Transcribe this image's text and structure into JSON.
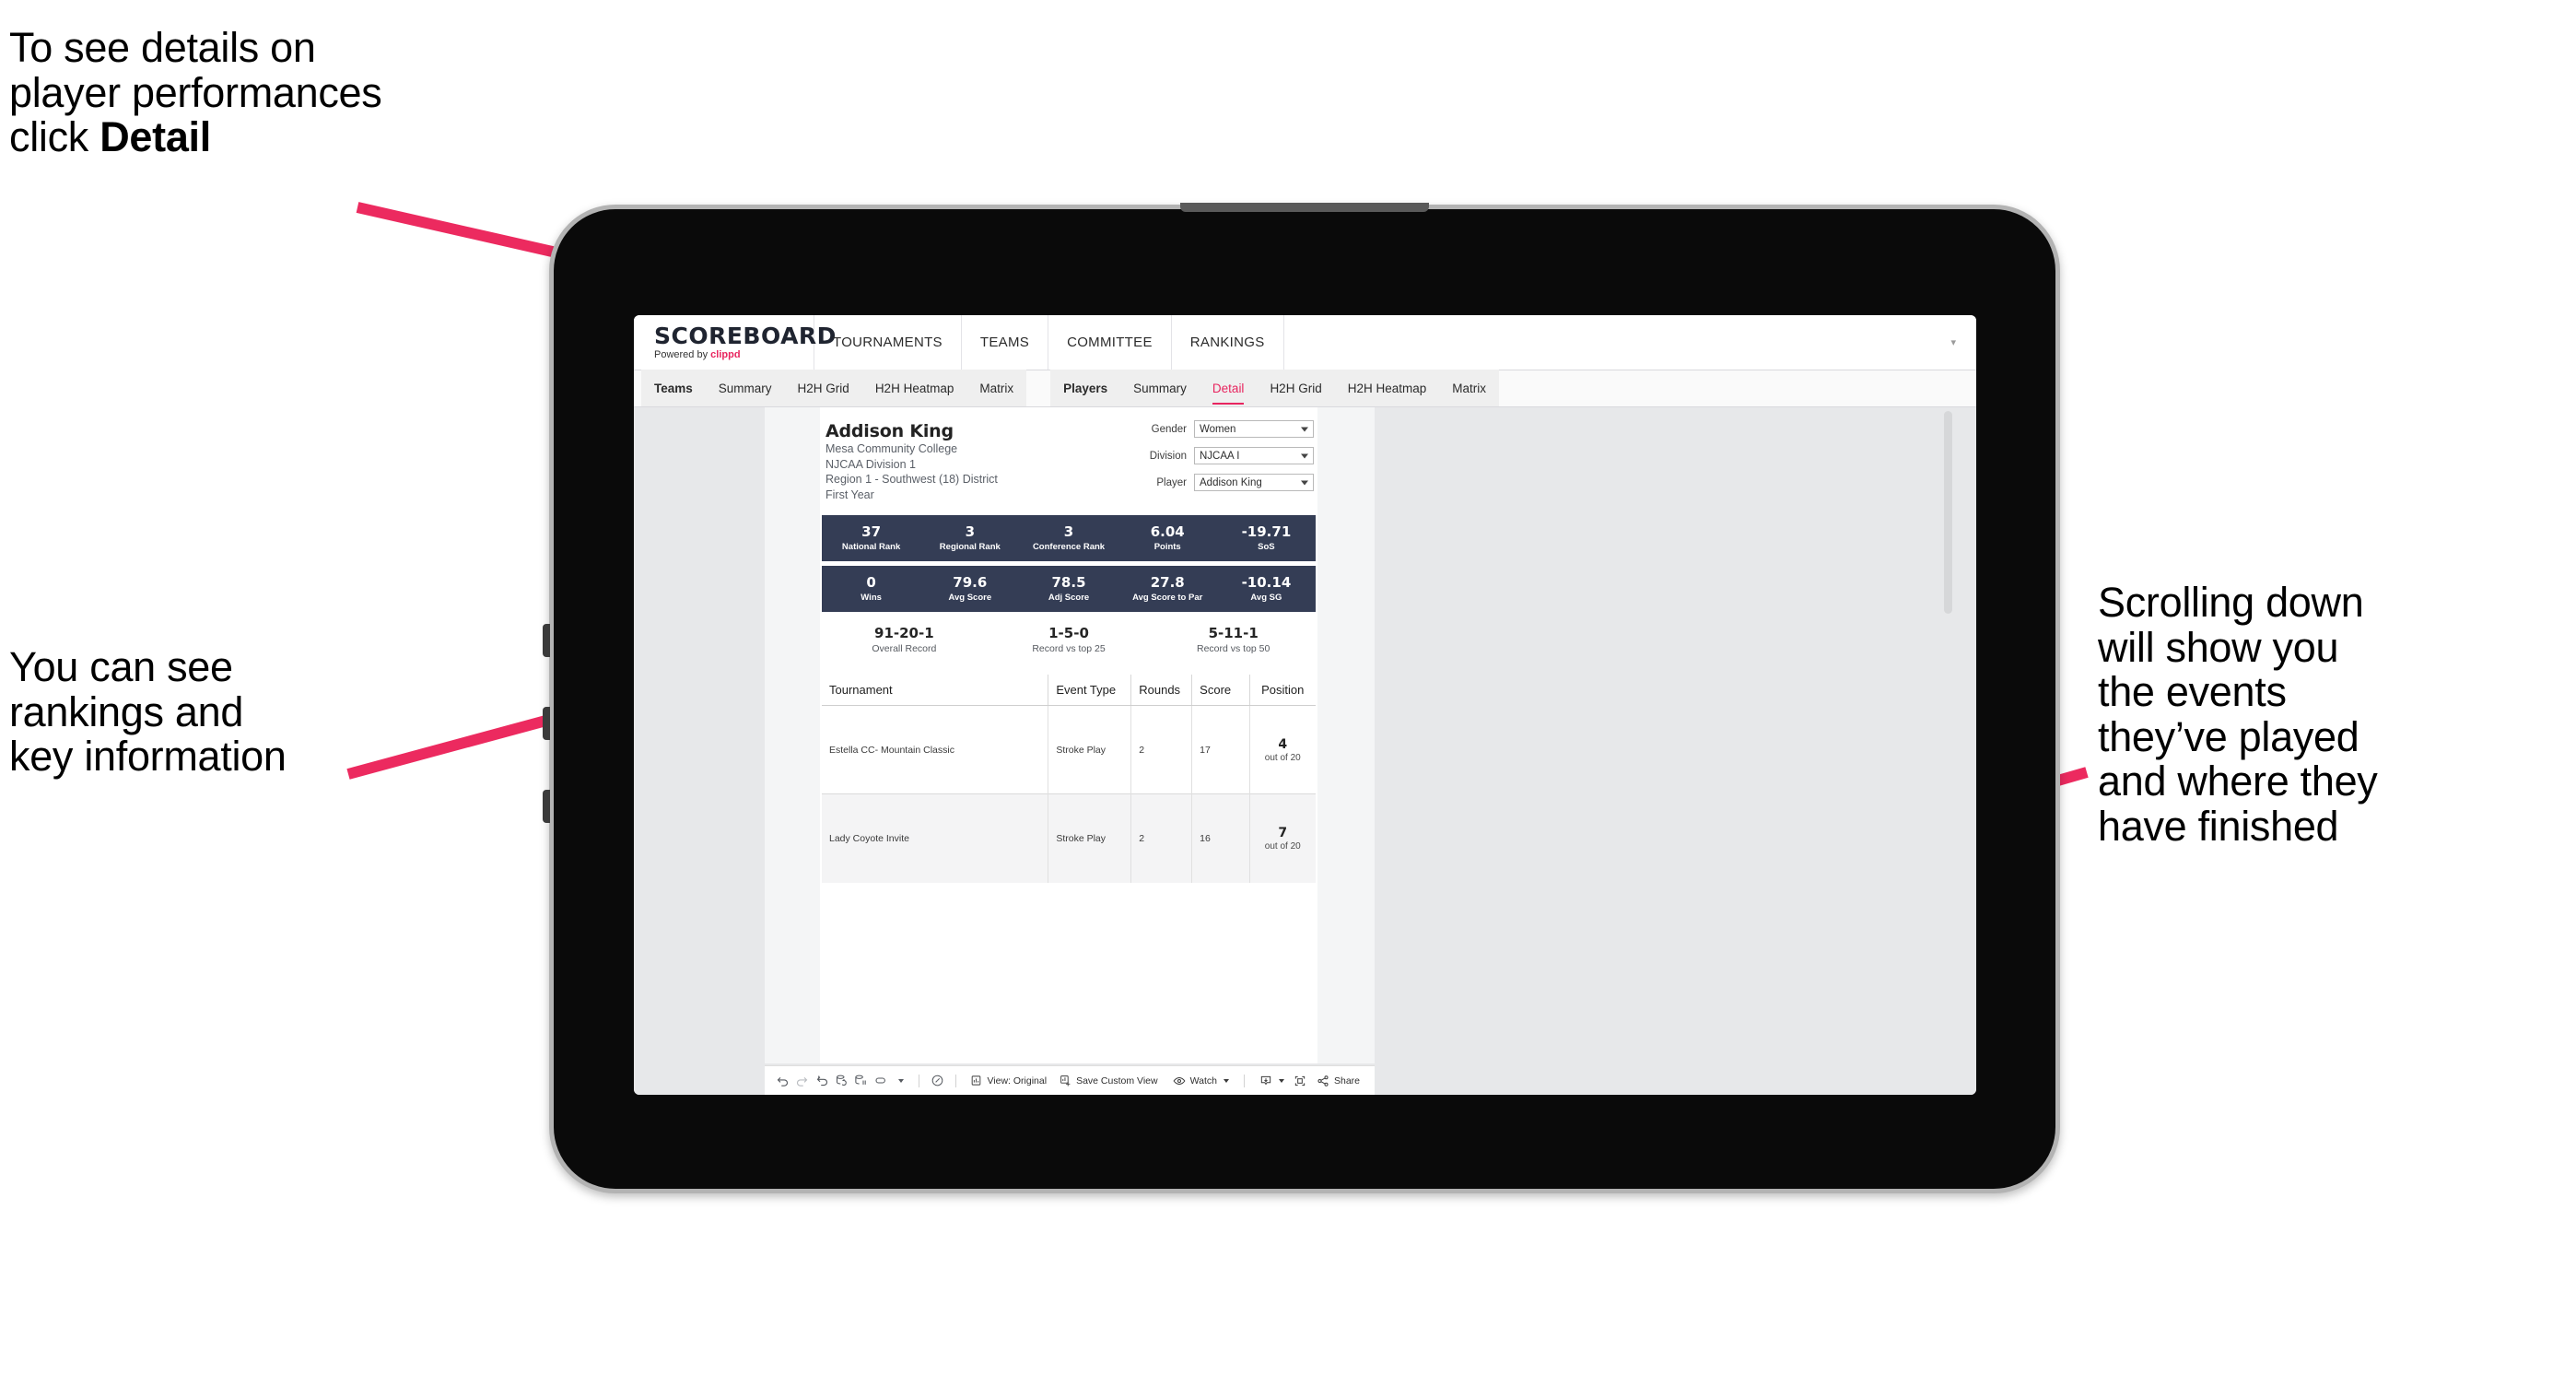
{
  "annotations": {
    "detail_note": {
      "line1": "To see details on",
      "line2": "player performances",
      "line3_pre": "click ",
      "line3_bold": "Detail"
    },
    "rankings_note": {
      "line1": "You can see",
      "line2": "rankings and",
      "line3": "key information"
    },
    "scroll_note": {
      "line1": "Scrolling down",
      "line2": "will show you",
      "line3": "the events",
      "line4": "they’ve played",
      "line5": "and where they",
      "line6": "have finished"
    },
    "arrow_color": "#ec2a5f"
  },
  "app": {
    "brand": {
      "title": "SCOREBOARD",
      "powered_prefix": "Powered by ",
      "powered_name": "clippd"
    },
    "top_nav": [
      "TOURNAMENTS",
      "TEAMS",
      "COMMITTEE",
      "RANKINGS"
    ],
    "subnav": {
      "teams_group": {
        "label": "Teams",
        "tabs": [
          "Summary",
          "H2H Grid",
          "H2H Heatmap",
          "Matrix"
        ]
      },
      "players_group": {
        "label": "Players",
        "tabs": [
          "Summary",
          "Detail",
          "H2H Grid",
          "H2H Heatmap",
          "Matrix"
        ],
        "active": "Detail"
      }
    },
    "accent_color": "#e8255f",
    "dark_bar_color": "#343d55"
  },
  "player": {
    "name": "Addison King",
    "college": "Mesa Community College",
    "division": "NJCAA Division 1",
    "region": "Region 1 - Southwest (18) District",
    "year": "First Year"
  },
  "filters": [
    {
      "label": "Gender",
      "value": "Women"
    },
    {
      "label": "Division",
      "value": "NJCAA I"
    },
    {
      "label": "Player",
      "value": "Addison King"
    }
  ],
  "stats_row_1": [
    {
      "value": "37",
      "label": "National Rank"
    },
    {
      "value": "3",
      "label": "Regional Rank"
    },
    {
      "value": "3",
      "label": "Conference Rank"
    },
    {
      "value": "6.04",
      "label": "Points"
    },
    {
      "value": "-19.71",
      "label": "SoS"
    }
  ],
  "stats_row_2": [
    {
      "value": "0",
      "label": "Wins"
    },
    {
      "value": "79.6",
      "label": "Avg Score"
    },
    {
      "value": "78.5",
      "label": "Adj Score"
    },
    {
      "value": "27.8",
      "label": "Avg Score to Par"
    },
    {
      "value": "-10.14",
      "label": "Avg SG"
    }
  ],
  "records": [
    {
      "value": "91-20-1",
      "label": "Overall Record"
    },
    {
      "value": "1-5-0",
      "label": "Record vs top 25"
    },
    {
      "value": "5-11-1",
      "label": "Record vs top 50"
    }
  ],
  "table": {
    "columns": [
      "Tournament",
      "Event Type",
      "Rounds",
      "Score",
      "Position"
    ],
    "rows": [
      {
        "tournament": "Estella CC- Mountain Classic",
        "event_type": "Stroke Play",
        "rounds": "2",
        "score": "17",
        "position": "4",
        "position_sub": "out of 20"
      },
      {
        "tournament": "Lady Coyote Invite",
        "event_type": "Stroke Play",
        "rounds": "2",
        "score": "16",
        "position": "7",
        "position_sub": "out of 20"
      }
    ]
  },
  "toolbar": {
    "view_label": "View: Original",
    "save_label": "Save Custom View",
    "watch_label": "Watch",
    "share_label": "Share"
  }
}
